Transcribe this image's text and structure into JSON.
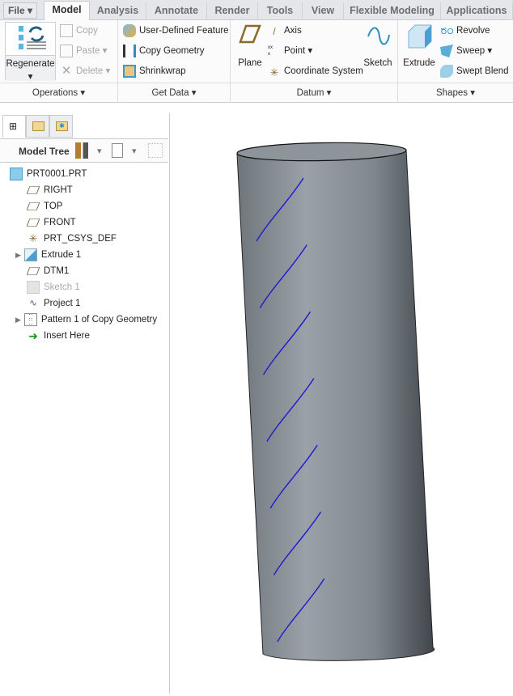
{
  "menu": {
    "file": "File",
    "tabs": [
      "Model",
      "Analysis",
      "Annotate",
      "Render",
      "Tools",
      "View",
      "Flexible Modeling",
      "Applications"
    ]
  },
  "ribbon": {
    "operations": {
      "label": "Operations",
      "regenerate": "Regenerate",
      "copy": "Copy",
      "paste": "Paste",
      "delete": "Delete"
    },
    "get_data": {
      "label": "Get Data",
      "udf": "User-Defined Feature",
      "copy_geometry": "Copy Geometry",
      "shrinkwrap": "Shrinkwrap"
    },
    "datum": {
      "label": "Datum",
      "plane": "Plane",
      "axis": "Axis",
      "point": "Point",
      "csys": "Coordinate System",
      "sketch": "Sketch"
    },
    "shapes": {
      "label": "Shapes",
      "extrude": "Extrude",
      "revolve": "Revolve",
      "sweep": "Sweep",
      "swept_blend": "Swept Blend"
    }
  },
  "model_tree": {
    "title": "Model Tree",
    "items": [
      "PRT0001.PRT",
      "RIGHT",
      "TOP",
      "FRONT",
      "PRT_CSYS_DEF",
      "Extrude 1",
      "DTM1",
      "Sketch 1",
      "Project 1",
      "Pattern 1 of Copy Geometry",
      "Insert Here"
    ]
  },
  "colors": {
    "accent": "#2f6fb8",
    "curve": "#1a1ad0",
    "cylinder": "#8a9299"
  }
}
